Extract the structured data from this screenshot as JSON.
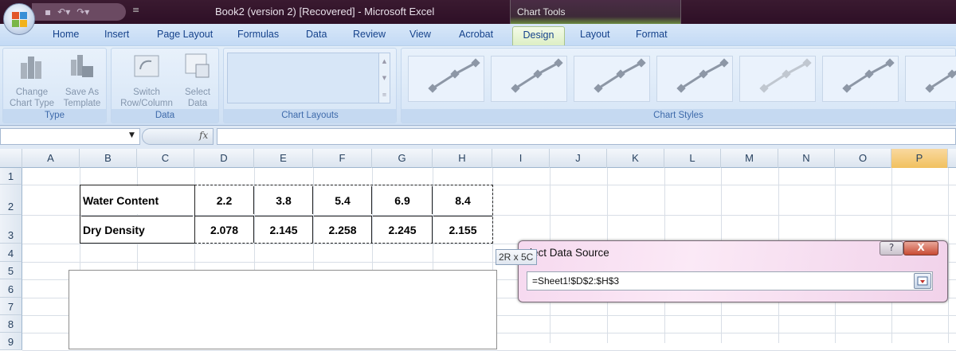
{
  "window": {
    "title": "Book2 (version 2) [Recovered] - Microsoft Excel",
    "context_tab_group": "Chart Tools"
  },
  "quick_access": {
    "save_icon": "save-icon",
    "undo_icon": "undo-icon",
    "redo_icon": "redo-icon",
    "customize_icon": "customize-icon"
  },
  "tabs": [
    {
      "label": "Home"
    },
    {
      "label": "Insert"
    },
    {
      "label": "Page Layout"
    },
    {
      "label": "Formulas"
    },
    {
      "label": "Data"
    },
    {
      "label": "Review"
    },
    {
      "label": "View"
    },
    {
      "label": "Acrobat"
    },
    {
      "label": "Design",
      "active": true
    },
    {
      "label": "Layout"
    },
    {
      "label": "Format"
    }
  ],
  "ribbon": {
    "groups": [
      {
        "label": "Type",
        "buttons": [
          {
            "line1": "Change",
            "line2": "Chart Type"
          },
          {
            "line1": "Save As",
            "line2": "Template"
          }
        ]
      },
      {
        "label": "Data",
        "buttons": [
          {
            "line1": "Switch",
            "line2": "Row/Column"
          },
          {
            "line1": "Select",
            "line2": "Data"
          }
        ]
      },
      {
        "label": "Chart Layouts"
      },
      {
        "label": "Chart Styles"
      }
    ]
  },
  "formula_bar": {
    "name_box": "",
    "fx": "fx",
    "formula": ""
  },
  "columns": [
    "A",
    "B",
    "C",
    "D",
    "E",
    "F",
    "G",
    "H",
    "I",
    "J",
    "K",
    "L",
    "M",
    "N",
    "O",
    "P"
  ],
  "selected_column": "P",
  "rows": [
    "1",
    "2",
    "3",
    "4",
    "5",
    "6",
    "7",
    "8",
    "9"
  ],
  "table": {
    "rows": [
      {
        "label": "Water Content",
        "values": [
          "2.2",
          "3.8",
          "5.4",
          "6.9",
          "8.4"
        ]
      },
      {
        "label": "Dry Density",
        "values": [
          "2.078",
          "2.145",
          "2.258",
          "2.245",
          "2.155"
        ]
      }
    ]
  },
  "selection_tooltip": "2R x 5C",
  "dialog": {
    "title": "lect Data Source",
    "help": "?",
    "close": "X",
    "range_value": "=Sheet1!$D$2:$H$3"
  },
  "colors": {
    "titlebar": "#2e0f26",
    "ribbon": "#d6e5f6",
    "tab_text": "#15428b",
    "selected_column": "#f1c15f"
  }
}
